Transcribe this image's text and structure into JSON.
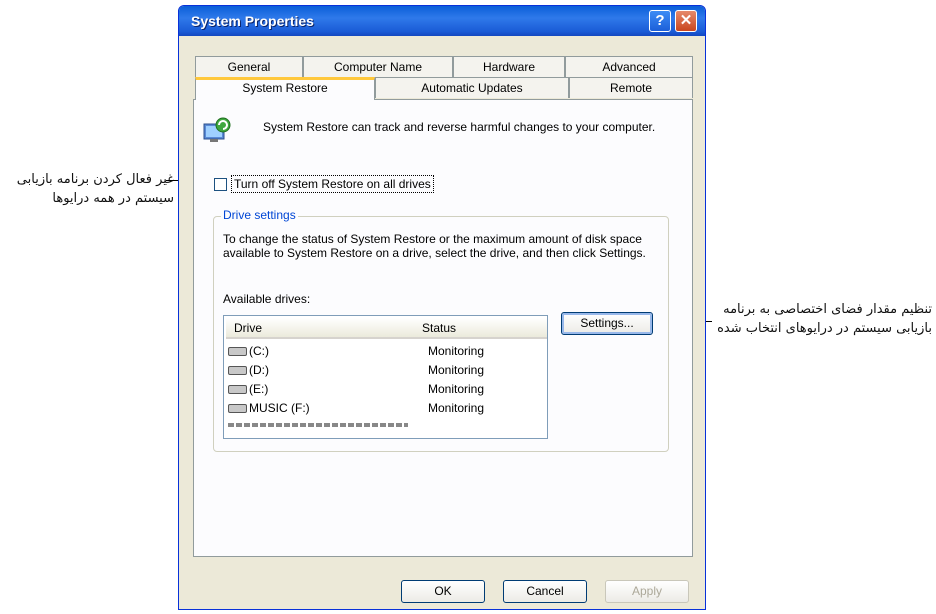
{
  "annotations": {
    "left": "غیر فعال کردن برنامه بازیابی سیستم در همه درایوها",
    "right": "تنظیم مقدار فضای اختصاصی به برنامه بازیابی سیستم در درایوهای انتخاب شده"
  },
  "window": {
    "title": "System Properties",
    "help_label": "?",
    "close_label": "✕"
  },
  "tabs_row1": [
    "General",
    "Computer Name",
    "Hardware",
    "Advanced"
  ],
  "tabs_row2": [
    "System Restore",
    "Automatic Updates",
    "Remote"
  ],
  "description": "System Restore can track and reverse harmful changes to your computer.",
  "checkbox_label": "Turn off System Restore on all drives",
  "drive_settings": {
    "label": "Drive settings",
    "text": "To change the status of System Restore or the maximum amount of disk space available to System Restore on a drive, select the drive, and then click Settings.",
    "available_label": "Available drives:"
  },
  "drives_table": {
    "columns": [
      "Drive",
      "Status"
    ],
    "rows": [
      {
        "drive": "(C:)",
        "status": "Monitoring"
      },
      {
        "drive": "(D:)",
        "status": "Monitoring"
      },
      {
        "drive": "(E:)",
        "status": "Monitoring"
      },
      {
        "drive": "MUSIC (F:)",
        "status": "Monitoring"
      }
    ]
  },
  "buttons": {
    "settings": "Settings...",
    "ok": "OK",
    "cancel": "Cancel",
    "apply": "Apply"
  },
  "colors": {
    "titlebar": "#0a5fd8",
    "dialog_bg": "#ece9d8",
    "active_tab_accent": "#ffc83c",
    "group_label": "#0046d5"
  }
}
